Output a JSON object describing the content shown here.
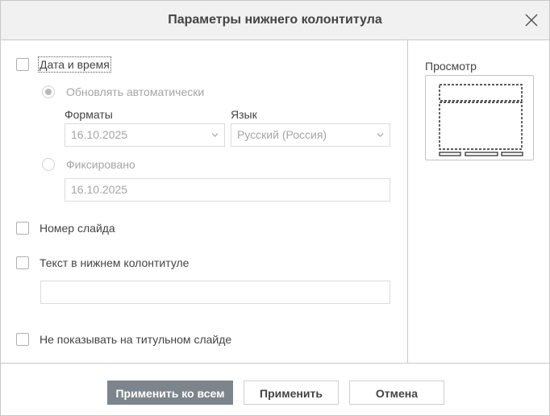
{
  "dialog": {
    "title": "Параметры нижнего колонтитула"
  },
  "options": {
    "date_time": {
      "label": "Дата и время",
      "checked": false
    },
    "update_auto": {
      "label": "Обновлять автоматически",
      "selected": true
    },
    "formats": {
      "label": "Форматы",
      "value": "16.10.2025"
    },
    "language": {
      "label": "Язык",
      "value": "Русский (Россия)"
    },
    "fixed": {
      "label": "Фиксировано",
      "selected": false,
      "value": "16.10.2025"
    },
    "slide_number": {
      "label": "Номер слайда",
      "checked": false
    },
    "footer_text": {
      "label": "Текст в нижнем колонтитуле",
      "checked": false,
      "value": ""
    },
    "hide_on_title": {
      "label": "Не показывать на титульном слайде",
      "checked": false
    }
  },
  "preview": {
    "label": "Просмотр"
  },
  "buttons": {
    "apply_all": "Применить ко всем",
    "apply": "Применить",
    "cancel": "Отмена"
  },
  "icons": {
    "close": "close-icon",
    "dropdown": "chevron-down-icon"
  },
  "colors": {
    "primary_button": "#7d858c",
    "header_bg": "#f1f1f1"
  }
}
